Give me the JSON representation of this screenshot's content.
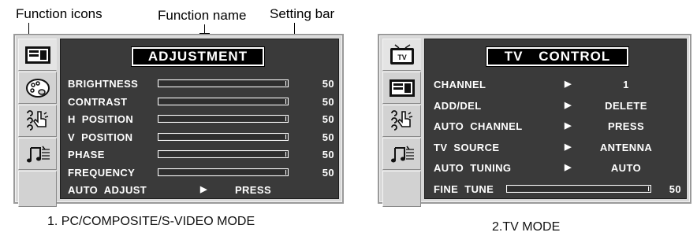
{
  "annotations": {
    "function_icons": "Function icons",
    "function_name": "Function name",
    "setting_bar": "Setting bar"
  },
  "left_osd": {
    "caption": "1. PC/COMPOSITE/S-VIDEO MODE",
    "title": "ADJUSTMENT",
    "tabs": [
      "adjustment-icon",
      "palette-icon",
      "hand-pointer-icon",
      "music-note-icon",
      "empty"
    ],
    "rows": [
      {
        "label": "BRIGHTNESS",
        "type": "bar",
        "value": "50",
        "level": 1.0
      },
      {
        "label": "CONTRAST",
        "type": "bar",
        "value": "50",
        "level": 1.0
      },
      {
        "label": "H  POSITION",
        "type": "bar",
        "value": "50",
        "level": 1.0
      },
      {
        "label": "V  POSITION",
        "type": "bar",
        "value": "50",
        "level": 1.0
      },
      {
        "label": "PHASE",
        "type": "bar",
        "value": "50",
        "level": 1.0
      },
      {
        "label": "FREQUENCY",
        "type": "bar",
        "value": "50",
        "level": 1.0
      },
      {
        "label": "AUTO  ADJUST",
        "type": "option",
        "arrow": "▶",
        "option": "PRESS"
      }
    ]
  },
  "right_osd": {
    "caption": "2.TV MODE",
    "title": "TV  CONTROL",
    "tabs": [
      "tv-icon",
      "adjustment-icon",
      "hand-pointer-icon",
      "music-note-icon",
      "empty"
    ],
    "rows": [
      {
        "label": "CHANNEL",
        "type": "option",
        "arrow": "▶",
        "option": "1"
      },
      {
        "label": "ADD/DEL",
        "type": "option",
        "arrow": "▶",
        "option": "DELETE"
      },
      {
        "label": "AUTO  CHANNEL",
        "type": "option",
        "arrow": "▶",
        "option": "PRESS"
      },
      {
        "label": "TV  SOURCE",
        "type": "option",
        "arrow": "▶",
        "option": "ANTENNA"
      },
      {
        "label": "AUTO  TUNING",
        "type": "option",
        "arrow": "▶",
        "option": "AUTO"
      },
      {
        "label": "FINE  TUNE",
        "type": "bar",
        "value": "50",
        "level": 1.0
      }
    ]
  },
  "tab_icons": {
    "tv_label": "TV"
  }
}
